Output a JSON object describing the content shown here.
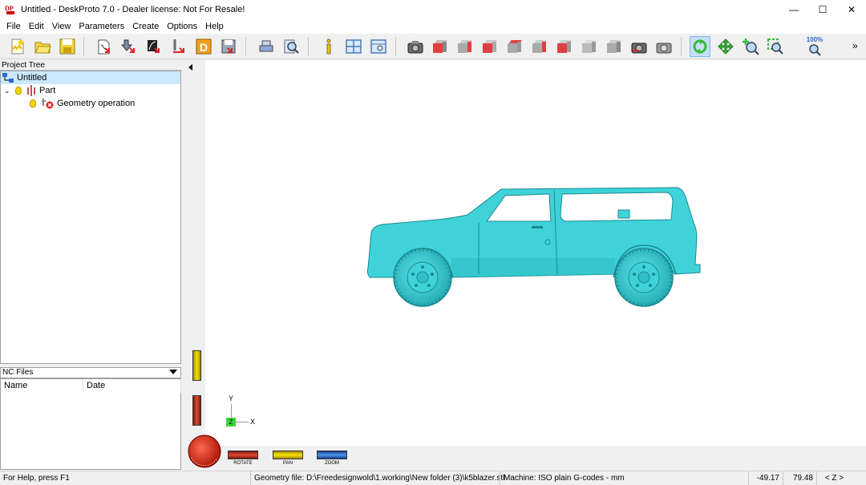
{
  "window": {
    "title": "Untitled - DeskProto 7.0 - Dealer license: Not For Resale!",
    "min_glyph": "—",
    "max_glyph": "☐",
    "close_glyph": "✕",
    "app_icon": "deskproto-logo-icon"
  },
  "menu": [
    "File",
    "Edit",
    "View",
    "Parameters",
    "Create",
    "Options",
    "Help"
  ],
  "toolbar": {
    "zoom_label": "100%",
    "overflow_glyph": "»",
    "icons": [
      "new-file-icon",
      "open-folder-icon",
      "save-icon",
      "import-geometry-icon",
      "import-vector-icon",
      "import-bitmap-icon",
      "import-image-icon",
      "dxf-export-icon",
      "export-icon",
      "print-icon",
      "print-preview-icon",
      "info-icon",
      "layout-icon",
      "view-options-icon",
      "camera-icon",
      "view-iso-icon",
      "view-front-icon",
      "view-right-icon",
      "view-left-icon",
      "view-back-icon",
      "view-top-icon",
      "view-bottom-icon",
      "view-shaded-icon",
      "snapshot-icon",
      "snapshot-settings-icon",
      "rotate-mode-icon",
      "pan-mode-icon",
      "zoom-mode-icon",
      "zoom-window-icon",
      "zoom-100-icon"
    ]
  },
  "project_tree": {
    "header": "Project Tree",
    "root": "Untitled",
    "part": "Part",
    "operation": "Geometry operation"
  },
  "nc_files": {
    "header": "NC Files",
    "col_name": "Name",
    "col_date": "Date"
  },
  "viewport": {
    "axis_y": "Y",
    "axis_z": "Z",
    "axis_x": "X",
    "model_color": "#3fd3d9",
    "slider_labels": {
      "rotate": "ROTATE",
      "pan": "PAN",
      "zoom": "ZOOM"
    }
  },
  "status": {
    "help": "For Help, press F1",
    "geometry_file": "Geometry file: D:\\Freedesignwold\\1.working\\New folder (3)\\k5blazer.stl",
    "machine": "Machine: ISO plain G-codes - mm",
    "coord_x": "-49.17",
    "coord_y": "79.48",
    "axis": "< Z >"
  }
}
